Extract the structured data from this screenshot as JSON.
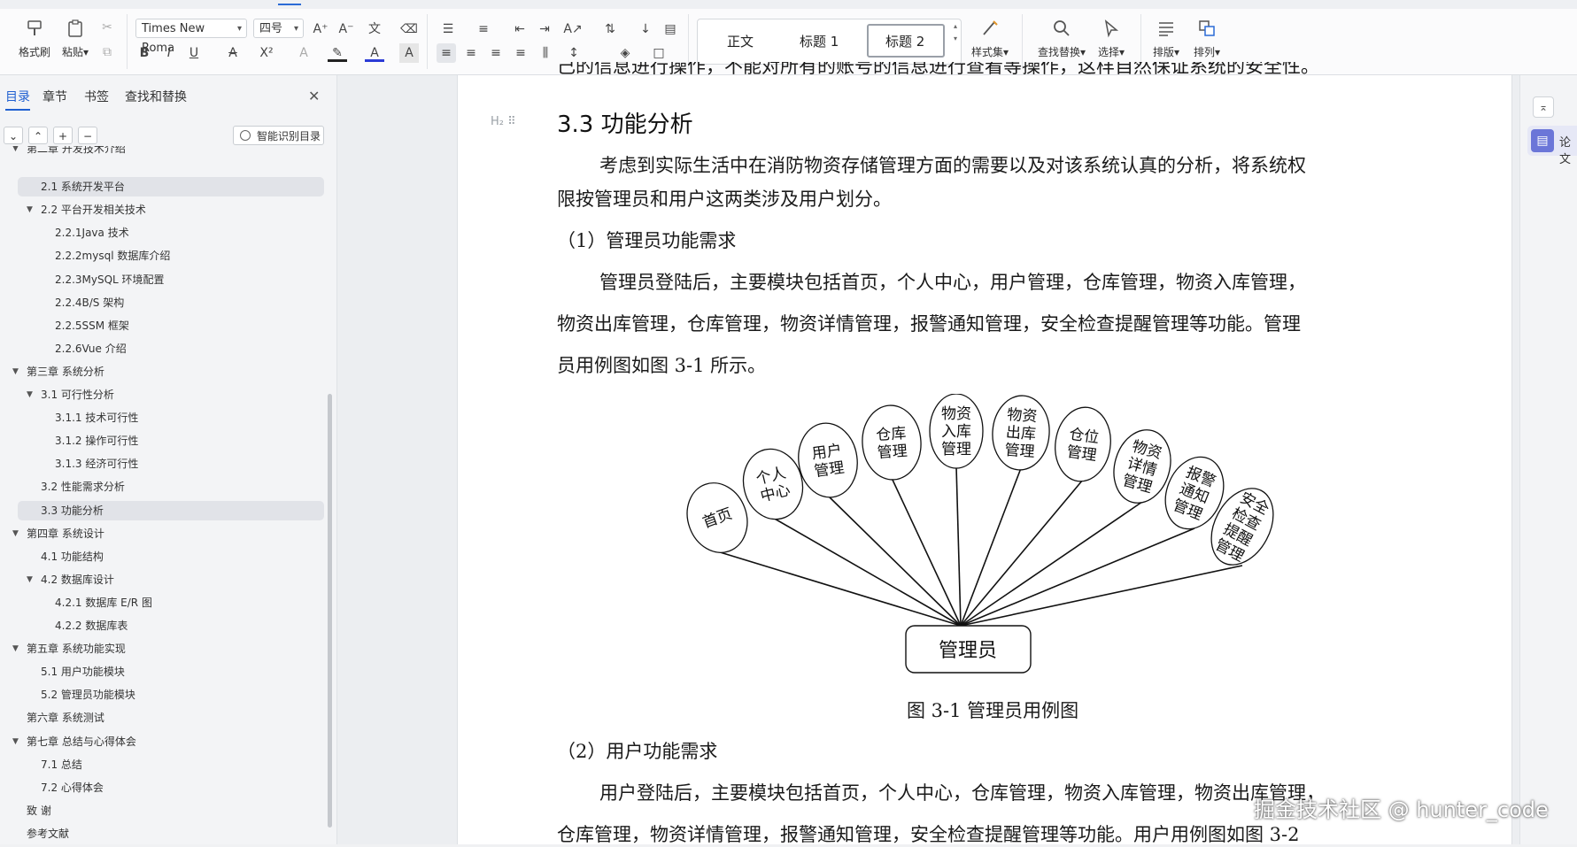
{
  "ribbon": {
    "format_painter": "格式刷",
    "paste": "粘贴",
    "font_name": "Times New Roma",
    "font_size": "四号",
    "styles": {
      "normal": "正文",
      "heading1": "标题 1",
      "heading2": "标题 2"
    },
    "style_set": "样式集",
    "find_replace": "查找替换",
    "select": "选择",
    "layout": "排版",
    "arrange": "排列"
  },
  "nav": {
    "tabs": [
      "目录",
      "章节",
      "书签",
      "查找和替换"
    ],
    "smart_button": "智能识别目录",
    "toc": [
      {
        "label": "第二章  开发技术介绍"
      },
      {
        "label": "2.1 系统开发平台"
      },
      {
        "label": "2.2 平台开发相关技术"
      },
      {
        "label": "2.2.1Java 技术"
      },
      {
        "label": "2.2.2mysql 数据库介绍"
      },
      {
        "label": "2.2.3MySQL 环境配置"
      },
      {
        "label": "2.2.4B/S 架构"
      },
      {
        "label": "2.2.5SSM 框架"
      },
      {
        "label": "2.2.6Vue 介绍"
      },
      {
        "label": "第三章  系统分析"
      },
      {
        "label": "3.1 可行性分析"
      },
      {
        "label": "3.1.1 技术可行性"
      },
      {
        "label": "3.1.2 操作可行性"
      },
      {
        "label": "3.1.3 经济可行性"
      },
      {
        "label": "3.2 性能需求分析"
      },
      {
        "label": "3.3 功能分析"
      },
      {
        "label": "第四章  系统设计"
      },
      {
        "label": "4.1 功能结构"
      },
      {
        "label": "4.2 数据库设计"
      },
      {
        "label": "4.2.1 数据库 E/R 图"
      },
      {
        "label": "4.2.2 数据库表"
      },
      {
        "label": "第五章  系统功能实现"
      },
      {
        "label": "5.1 用户功能模块"
      },
      {
        "label": "5.2  管理员功能模块"
      },
      {
        "label": "第六章  系统测试"
      },
      {
        "label": "第七章  总结与心得体会"
      },
      {
        "label": "7.1 总结"
      },
      {
        "label": "7.2 心得体会"
      },
      {
        "label": "致   谢"
      },
      {
        "label": "参考文献"
      }
    ]
  },
  "doc": {
    "top_partial": "己的信息进行操作，不能对所有的账号的信息进行查看等操作，这样自然保证系统的安全性。",
    "heading_marker": "H₂",
    "heading": "3.3 功能分析",
    "p1_line1": "考虑到实际生活中在消防物资存储管理方面的需要以及对该系统认真的分析，将系统权",
    "p1_line2": "限按管理员和用户这两类涉及用户划分。",
    "sub1": "（1）管理员功能需求",
    "p2_line1": "管理员登陆后，主要模块包括首页，个人中心，用户管理，仓库管理，物资入库管理，",
    "p2_line2": "物资出库管理，仓库管理，物资详情管理，报警通知管理，安全检查提醒管理等功能。管理",
    "p2_line3": "员用例图如图 3-1 所示。",
    "diagram": {
      "actor": "管理员",
      "usecases": [
        {
          "lines": [
            "首页"
          ]
        },
        {
          "lines": [
            "个人",
            "中心"
          ]
        },
        {
          "lines": [
            "用户",
            "管理"
          ]
        },
        {
          "lines": [
            "仓库",
            "管理"
          ]
        },
        {
          "lines": [
            "物资",
            "入库",
            "管理"
          ]
        },
        {
          "lines": [
            "物资",
            "出库",
            "管理"
          ]
        },
        {
          "lines": [
            "仓位",
            "管理"
          ]
        },
        {
          "lines": [
            "物资",
            "详情",
            "管理"
          ]
        },
        {
          "lines": [
            "报警",
            "通知",
            "管理"
          ]
        },
        {
          "lines": [
            "安全",
            "检查",
            "提醒",
            "管理"
          ]
        }
      ]
    },
    "caption": "图 3-1  管理员用例图",
    "sub2": "（2）用户功能需求",
    "p3_line1": "用户登陆后，主要模块包括首页，个人中心，仓库管理，物资入库管理，物资出库管理，",
    "p3_line2": "仓库管理，物资详情管理，报警通知管理，安全检查提醒管理等功能。用户用例图如图 3-2"
  },
  "right_panel": {
    "paper_label": "论文"
  },
  "watermark": "掘金技术社区 @ hunter_code"
}
